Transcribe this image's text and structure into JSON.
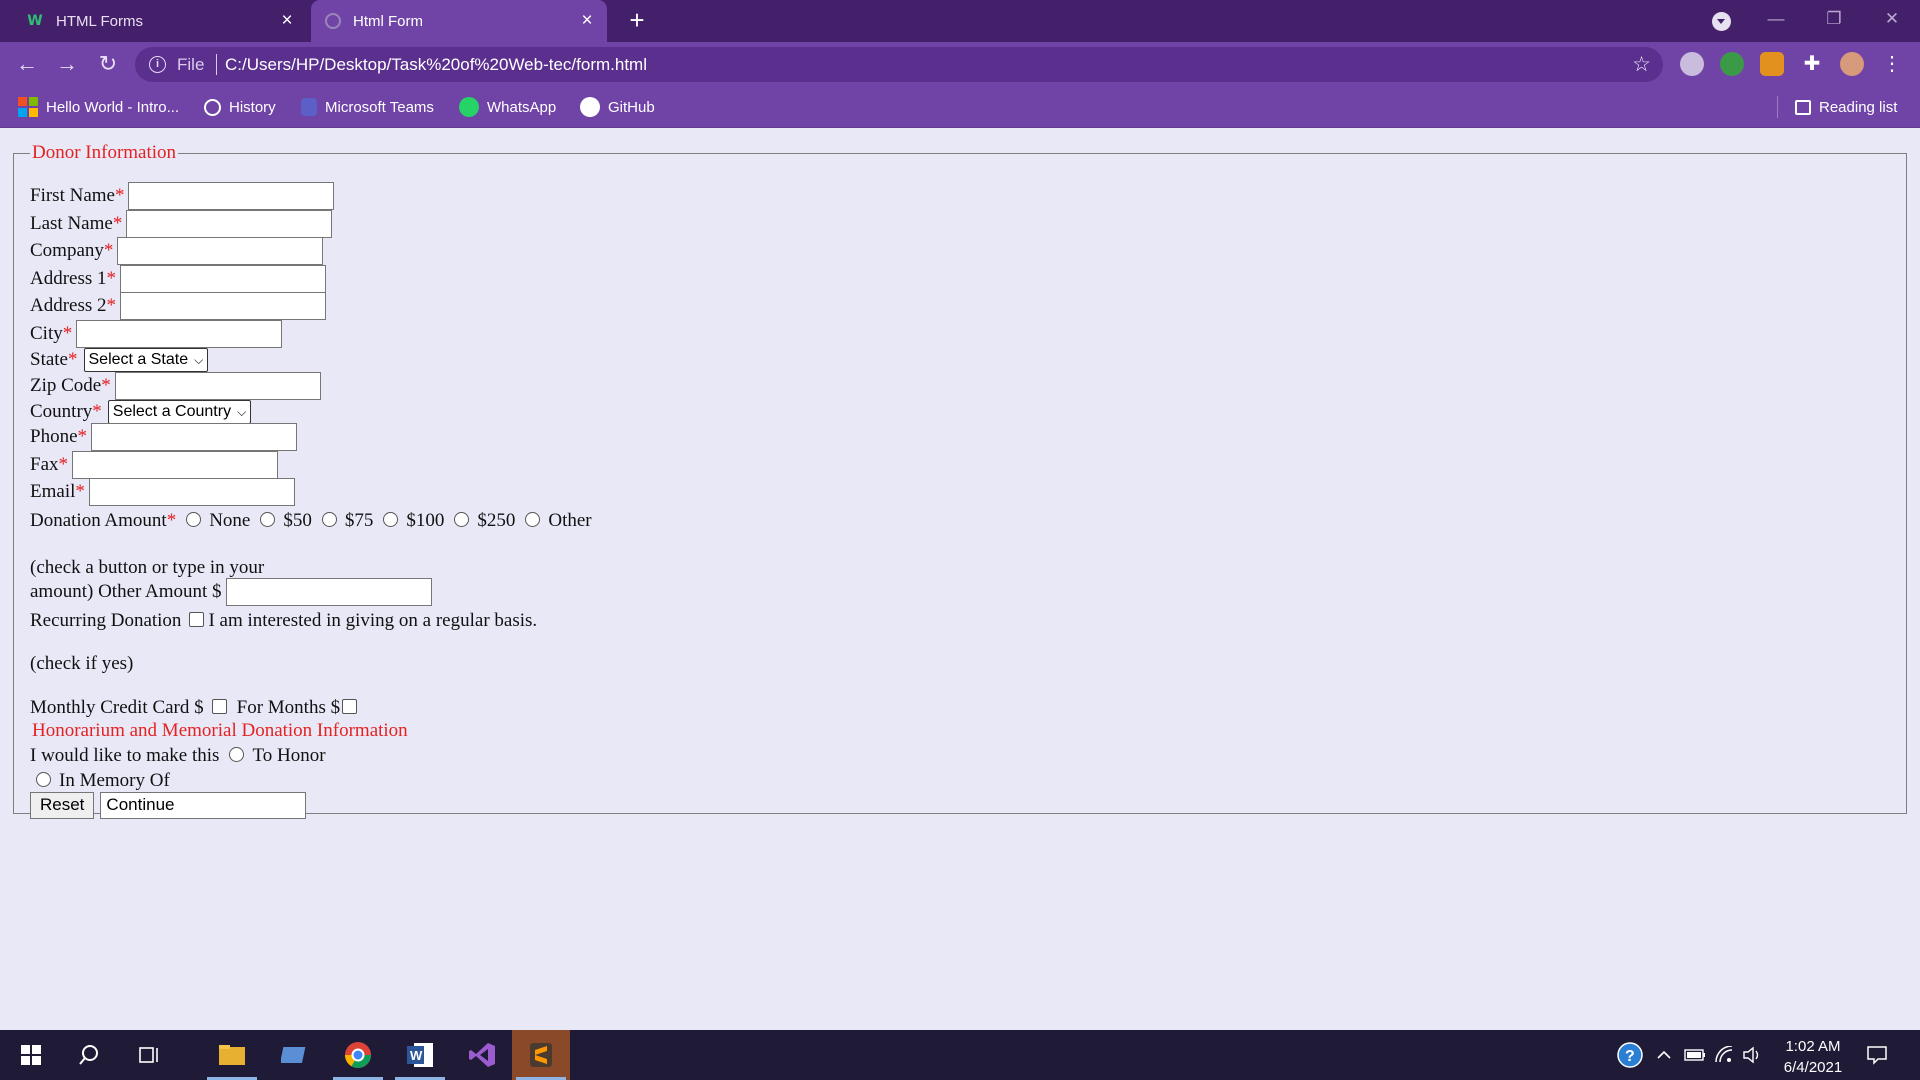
{
  "browser": {
    "tabs": [
      {
        "title": "HTML Forms",
        "active": false,
        "icon": "w3schools-icon"
      },
      {
        "title": "Html Form",
        "active": true,
        "icon": "globe-icon"
      }
    ],
    "new_tab": "+",
    "address": {
      "scheme_label": "File",
      "url": "C:/Users/HP/Desktop/Task%20of%20Web-tec/form.html"
    },
    "bookmarks": [
      {
        "label": "Hello World - Intro...",
        "icon": "microsoft-logo-icon"
      },
      {
        "label": "History",
        "icon": "history-icon"
      },
      {
        "label": "Microsoft Teams",
        "icon": "teams-icon"
      },
      {
        "label": "WhatsApp",
        "icon": "whatsapp-icon"
      },
      {
        "label": "GitHub",
        "icon": "github-icon"
      }
    ],
    "reading_list": "Reading list",
    "colors": {
      "tab_strip": "#45206a",
      "toolbar": "#7044a6",
      "page_bg": "#e8e8f7",
      "required": "#e52222"
    }
  },
  "form": {
    "legend": "Donor Information",
    "required_marker": "*",
    "fields": {
      "first_name": "First Name",
      "last_name": "Last Name",
      "company": "Company",
      "address1": "Address 1",
      "address2": "Address 2",
      "city": "City",
      "state": "State",
      "zip": "Zip Code",
      "country": "Country",
      "phone": "Phone",
      "fax": "Fax",
      "email": "Email"
    },
    "state_select": "Select a State",
    "country_select": "Select a Country",
    "donation_label": "Donation Amount",
    "donation_options": [
      "None",
      "$50",
      "$75",
      "$100",
      "$250",
      "Other"
    ],
    "other_hint_line1": "(check a button or type in your",
    "other_hint_line2": "amount) Other Amount $",
    "recurring_label": "Recurring Donation",
    "recurring_option": "I am interested in giving on a regular basis.",
    "check_if_yes": "(check if yes)",
    "monthly_label": "Monthly Credit Card $",
    "for_months_label": "For Months $",
    "honorarium_heading": "Honorarium and Memorial Donation Information",
    "honor_prompt": "I would like to make this",
    "honor_option": "To Honor",
    "memory_option": "In Memory Of",
    "reset_button": "Reset",
    "continue_button": "Continue"
  },
  "taskbar": {
    "apps": [
      "windows-start-icon",
      "search-icon",
      "task-view-icon",
      "file-explorer-icon",
      "control-panel-icon",
      "chrome-icon",
      "word-icon",
      "visual-studio-icon",
      "sublime-text-icon"
    ],
    "time": "1:02 AM",
    "date": "6/4/2021"
  }
}
